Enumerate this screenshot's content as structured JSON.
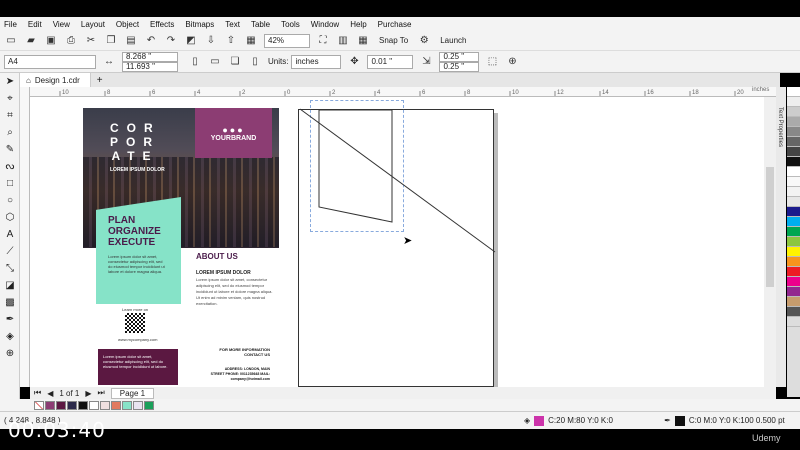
{
  "timer": "00:03:40",
  "watermark": "Udemy",
  "menu": [
    "File",
    "Edit",
    "View",
    "Layout",
    "Object",
    "Effects",
    "Bitmaps",
    "Text",
    "Table",
    "Tools",
    "Window",
    "Help",
    "Purchase"
  ],
  "toolbar1": {
    "zoom": "42%",
    "snap_to": "Snap To",
    "launch": "Launch"
  },
  "toolbar2": {
    "page_size": "A4",
    "width": "8.268 \"",
    "height": "11.693 \"",
    "units_label": "Units:",
    "units_value": "inches",
    "nudge": "0.01 \"",
    "dup_x": "0.25 \"",
    "dup_y": "0.25 \""
  },
  "tab": {
    "label": "Design 1.cdr"
  },
  "ruler_unit": "inches",
  "ruler_ticks": [
    "10",
    "8",
    "6",
    "4",
    "2",
    "0",
    "2",
    "4",
    "6",
    "8",
    "10",
    "12",
    "14",
    "16",
    "18",
    "20"
  ],
  "pagebar": {
    "page_count": "1 of 1",
    "page_label": "Page 1"
  },
  "docker_label": "Text Properties",
  "brochure": {
    "corporate": "COR POR ATE",
    "lorem_top": "LOREM IPSUM DOLOR",
    "brand": "YOURBRAND",
    "plan": "PLAN ORGANIZE EXECUTE",
    "mint_text": "Lorem ipsum dolor sit amet, consectetur adipiscing elit, sed do eiusmod tempor incididunt ut labore et dolore magna aliqua.",
    "about": "ABOUT US",
    "about_sub": "LOREM IPSUM DOLOR",
    "about_text": "Lorem ipsum dolor sit amet, consectetur adipiscing elit, sed do eiusmod tempor incididunt ut labore et dolore magna aliqua. Ut enim ad minim veniam, quis nostrud exercitation.",
    "learn": "Learn more on",
    "qr_url": "www.mycompany.com",
    "purple_text": "Lorem ipsum dolor sit amet, consectetur adipiscing elit, sed do eiusmod tempor incididunt ut labore.",
    "contact": "FOR MORE INFORMATION CONTACT US",
    "address": "ADDRESS: LONDON, MAIN STREET PHONE: 0011235648 MAIL: company@hotmail.com"
  },
  "status": {
    "coords": "( 4.248 , 8.848 )",
    "fill": "C:20 M:80 Y:0 K:0",
    "outline": "C:0 M:0 Y:0 K:100  0.500 pt"
  },
  "colors": {
    "brand_purple": "#8c3d73",
    "mint": "#86e3c8",
    "dark_purple": "#5b1841",
    "fill_swatch": "#cc33aa"
  }
}
